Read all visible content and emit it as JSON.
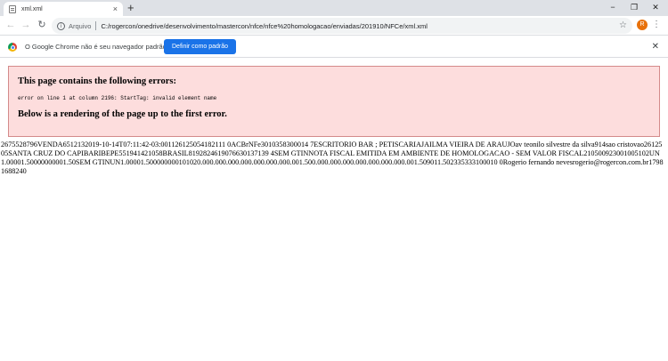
{
  "tabs": [
    {
      "title": "xml.xml",
      "close": "×"
    }
  ],
  "new_tab": "+",
  "window_controls": {
    "minimize": "−",
    "maximize": "❐",
    "close": "✕"
  },
  "nav": {
    "back": "←",
    "forward": "→",
    "reload": "↻"
  },
  "omnibox": {
    "info_glyph": "i",
    "scheme_label": "Arquivo",
    "url": "C:/rogercon/onedrive/desenvolvimento/mastercon/nfce/nfce%20homologacao/enviadas/201910/NFCe/xml.xml"
  },
  "toolbar": {
    "star": "☆",
    "avatar_letter": "R",
    "menu": "⋮"
  },
  "infobar": {
    "text": "O Google Chrome não é seu navegador padrão",
    "button_label": "Definir como padrão",
    "close": "✕"
  },
  "error_box": {
    "heading": "This page contains the following errors:",
    "message": "error on line 1 at column 2196: StartTag: invalid element name",
    "footer": "Below is a rendering of the page up to the first error."
  },
  "xml_content": "2675528796VENDA6512132019-10-14T07:11:42-03:001126125054182111 0ACBrNFe3010358300014 7ESCRITORIO BAR ; PETISCARIAJAILMA VIEIRA DE ARAUJOav teonilo silvestre da silva914sao cristovao2612505SANTA CRUZ DO CAPIBARIBEPE551941421058BRASIL8192824619076630137139 4SEM GTINNOTA FISCAL EMITIDA EM AMBIENTE DE HOMOLOGACAO - SEM VALOR FISCAL210500923001005102UN1.00001.50000000001.50SEM GTINUN1.00001.500000000101020.000.000.000.000.000.000.000.001.500.000.000.000.000.000.000.000.001.509011.502335333100010 0Rogerio fernando nevesrogerio@rogercon.com.br17981688240",
  "colors": {
    "error_bg": "#fddddd",
    "error_border": "#d48a8a",
    "accent": "#1a73e8",
    "avatar": "#e8710a"
  }
}
